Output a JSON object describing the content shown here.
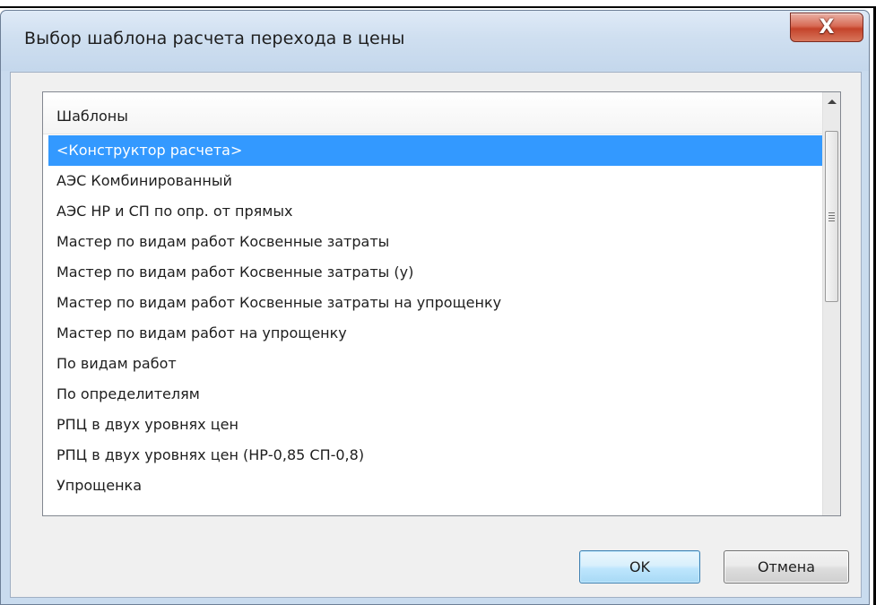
{
  "window": {
    "title": "Выбор шаблона расчета перехода в цены",
    "close_label": "X"
  },
  "list": {
    "header": "Шаблоны",
    "selected_index": 0,
    "items": [
      "<Конструктор расчета>",
      "АЭС Комбинированный",
      "АЭС НР и СП по опр. от прямых",
      "Мастер по видам работ Косвенные затраты",
      "Мастер по видам работ Косвенные затраты (у)",
      "Мастер по видам работ Косвенные затраты на упрощенку",
      "Мастер по видам работ на упрощенку",
      "По видам работ",
      "По определителям",
      "РПЦ в двух уровнях цен",
      "РПЦ в двух уровнях цен (НР-0,85 СП-0,8)",
      "Упрощенка"
    ]
  },
  "buttons": {
    "ok_label": "OK",
    "cancel_label": "Отмена"
  },
  "colors": {
    "selection": "#3399ff",
    "close_button": "#c4432a",
    "window_frame": "#c9dbee"
  }
}
